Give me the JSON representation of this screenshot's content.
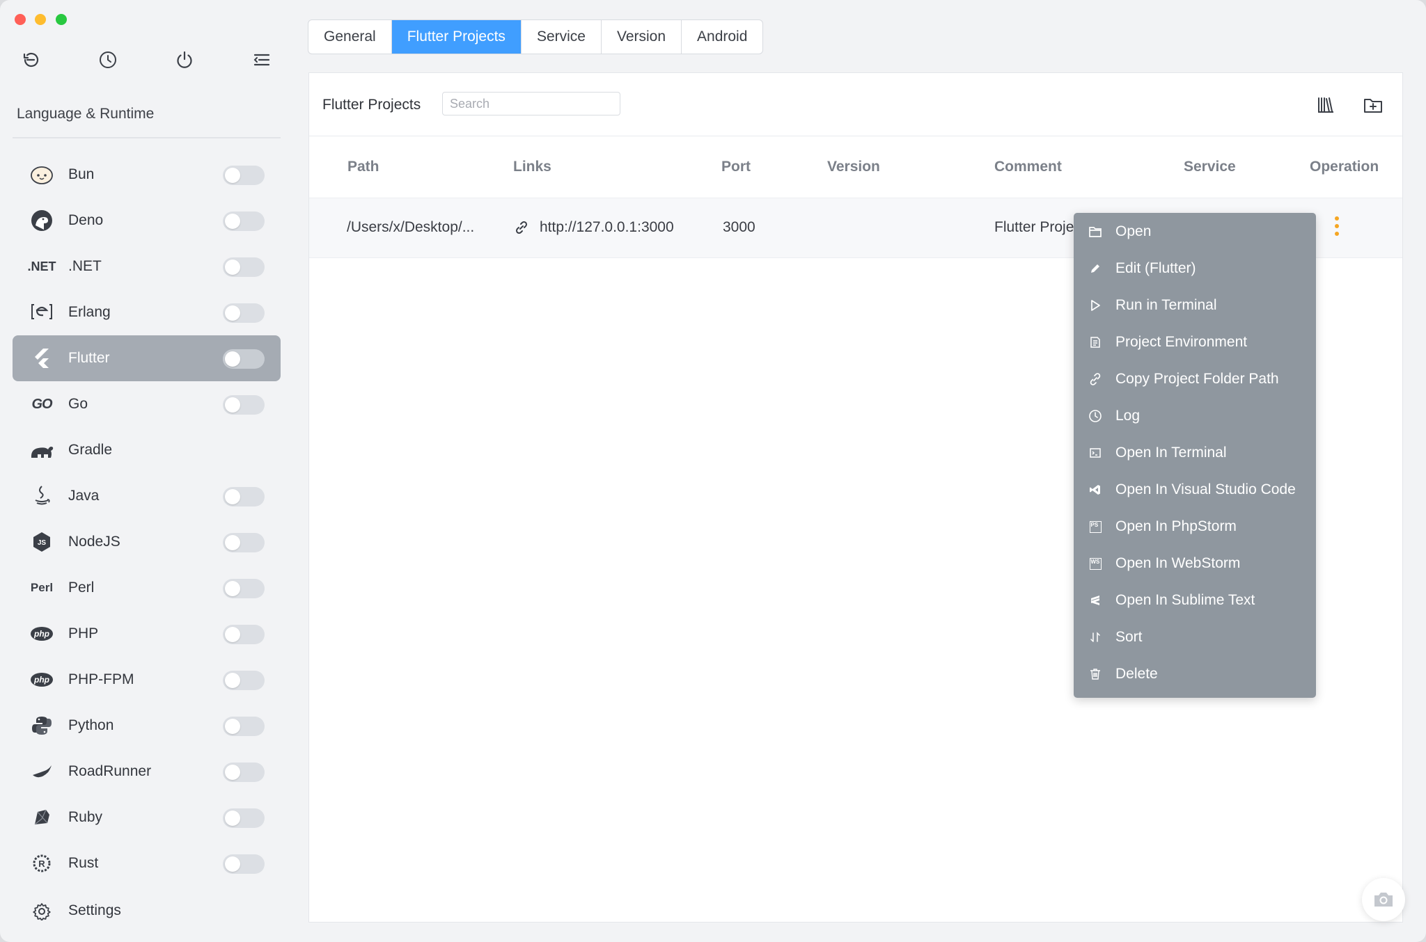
{
  "window": {
    "traffic_lights": [
      "close",
      "minimize",
      "zoom"
    ]
  },
  "sidebar": {
    "top_icons": [
      "back-icon",
      "history-icon",
      "power-icon",
      "menu-icon"
    ],
    "section_title": "Language & Runtime",
    "items": [
      {
        "label": "Bun",
        "icon": "bun-icon",
        "enabled": false,
        "has_toggle": true
      },
      {
        "label": "Deno",
        "icon": "deno-icon",
        "enabled": false,
        "has_toggle": true
      },
      {
        "label": ".NET",
        "icon": "dotnet-icon",
        "icon_text": ".NET",
        "enabled": false,
        "has_toggle": true
      },
      {
        "label": "Erlang",
        "icon": "erlang-icon",
        "enabled": false,
        "has_toggle": true
      },
      {
        "label": "Flutter",
        "icon": "flutter-icon",
        "enabled": false,
        "has_toggle": true,
        "active": true
      },
      {
        "label": "Go",
        "icon": "go-icon",
        "icon_text": "GO",
        "enabled": false,
        "has_toggle": true
      },
      {
        "label": "Gradle",
        "icon": "gradle-icon",
        "enabled": false,
        "has_toggle": false
      },
      {
        "label": "Java",
        "icon": "java-icon",
        "enabled": false,
        "has_toggle": true
      },
      {
        "label": "NodeJS",
        "icon": "nodejs-icon",
        "enabled": false,
        "has_toggle": true
      },
      {
        "label": "Perl",
        "icon": "perl-icon",
        "icon_text": "Perl",
        "enabled": false,
        "has_toggle": true
      },
      {
        "label": "PHP",
        "icon": "php-icon",
        "icon_text": "php",
        "enabled": false,
        "has_toggle": true
      },
      {
        "label": "PHP-FPM",
        "icon": "php-fpm-icon",
        "icon_text": "php",
        "enabled": false,
        "has_toggle": true
      },
      {
        "label": "Python",
        "icon": "python-icon",
        "enabled": false,
        "has_toggle": true
      },
      {
        "label": "RoadRunner",
        "icon": "roadrunner-icon",
        "enabled": false,
        "has_toggle": true
      },
      {
        "label": "Ruby",
        "icon": "ruby-icon",
        "enabled": false,
        "has_toggle": true
      },
      {
        "label": "Rust",
        "icon": "rust-icon",
        "enabled": false,
        "has_toggle": true
      }
    ],
    "settings_label": "Settings"
  },
  "tabs": [
    {
      "label": "General",
      "active": false
    },
    {
      "label": "Flutter Projects",
      "active": true
    },
    {
      "label": "Service",
      "active": false
    },
    {
      "label": "Version",
      "active": false
    },
    {
      "label": "Android",
      "active": false
    }
  ],
  "panel": {
    "title": "Flutter Projects",
    "search_placeholder": "Search",
    "header_buttons": [
      "library-icon",
      "add-folder-icon"
    ],
    "columns": [
      "Path",
      "Links",
      "Port",
      "Version",
      "Comment",
      "Service",
      "Operation"
    ],
    "rows": [
      {
        "path": "/Users/x/Desktop/...",
        "link": "http://127.0.0.1:3000",
        "port": "3000",
        "version": "",
        "comment": "Flutter Proje"
      }
    ]
  },
  "context_menu": {
    "items": [
      {
        "label": "Open",
        "icon": "folder-icon"
      },
      {
        "label": "Edit (Flutter)",
        "icon": "edit-icon"
      },
      {
        "label": "Run in Terminal",
        "icon": "play-icon"
      },
      {
        "label": "Project Environment",
        "icon": "document-icon"
      },
      {
        "label": "Copy Project Folder Path",
        "icon": "copy-link-icon"
      },
      {
        "label": "Log",
        "icon": "clock-icon"
      },
      {
        "label": "Open In Terminal",
        "icon": "terminal-icon"
      },
      {
        "label": "Open In Visual Studio Code",
        "icon": "vscode-icon"
      },
      {
        "label": "Open In PhpStorm",
        "icon": "phpstorm-icon",
        "icon_text": "PS"
      },
      {
        "label": "Open In WebStorm",
        "icon": "webstorm-icon",
        "icon_text": "WS"
      },
      {
        "label": "Open In Sublime Text",
        "icon": "sublime-icon"
      },
      {
        "label": "Sort",
        "icon": "sort-icon"
      },
      {
        "label": "Delete",
        "icon": "trash-icon"
      }
    ]
  },
  "colors": {
    "accent": "#409eff",
    "active_sidebar": "#a5abb3",
    "context_menu_bg": "#8f979f",
    "operation_kebab": "#f5a623"
  },
  "floating_button": "camera-icon"
}
